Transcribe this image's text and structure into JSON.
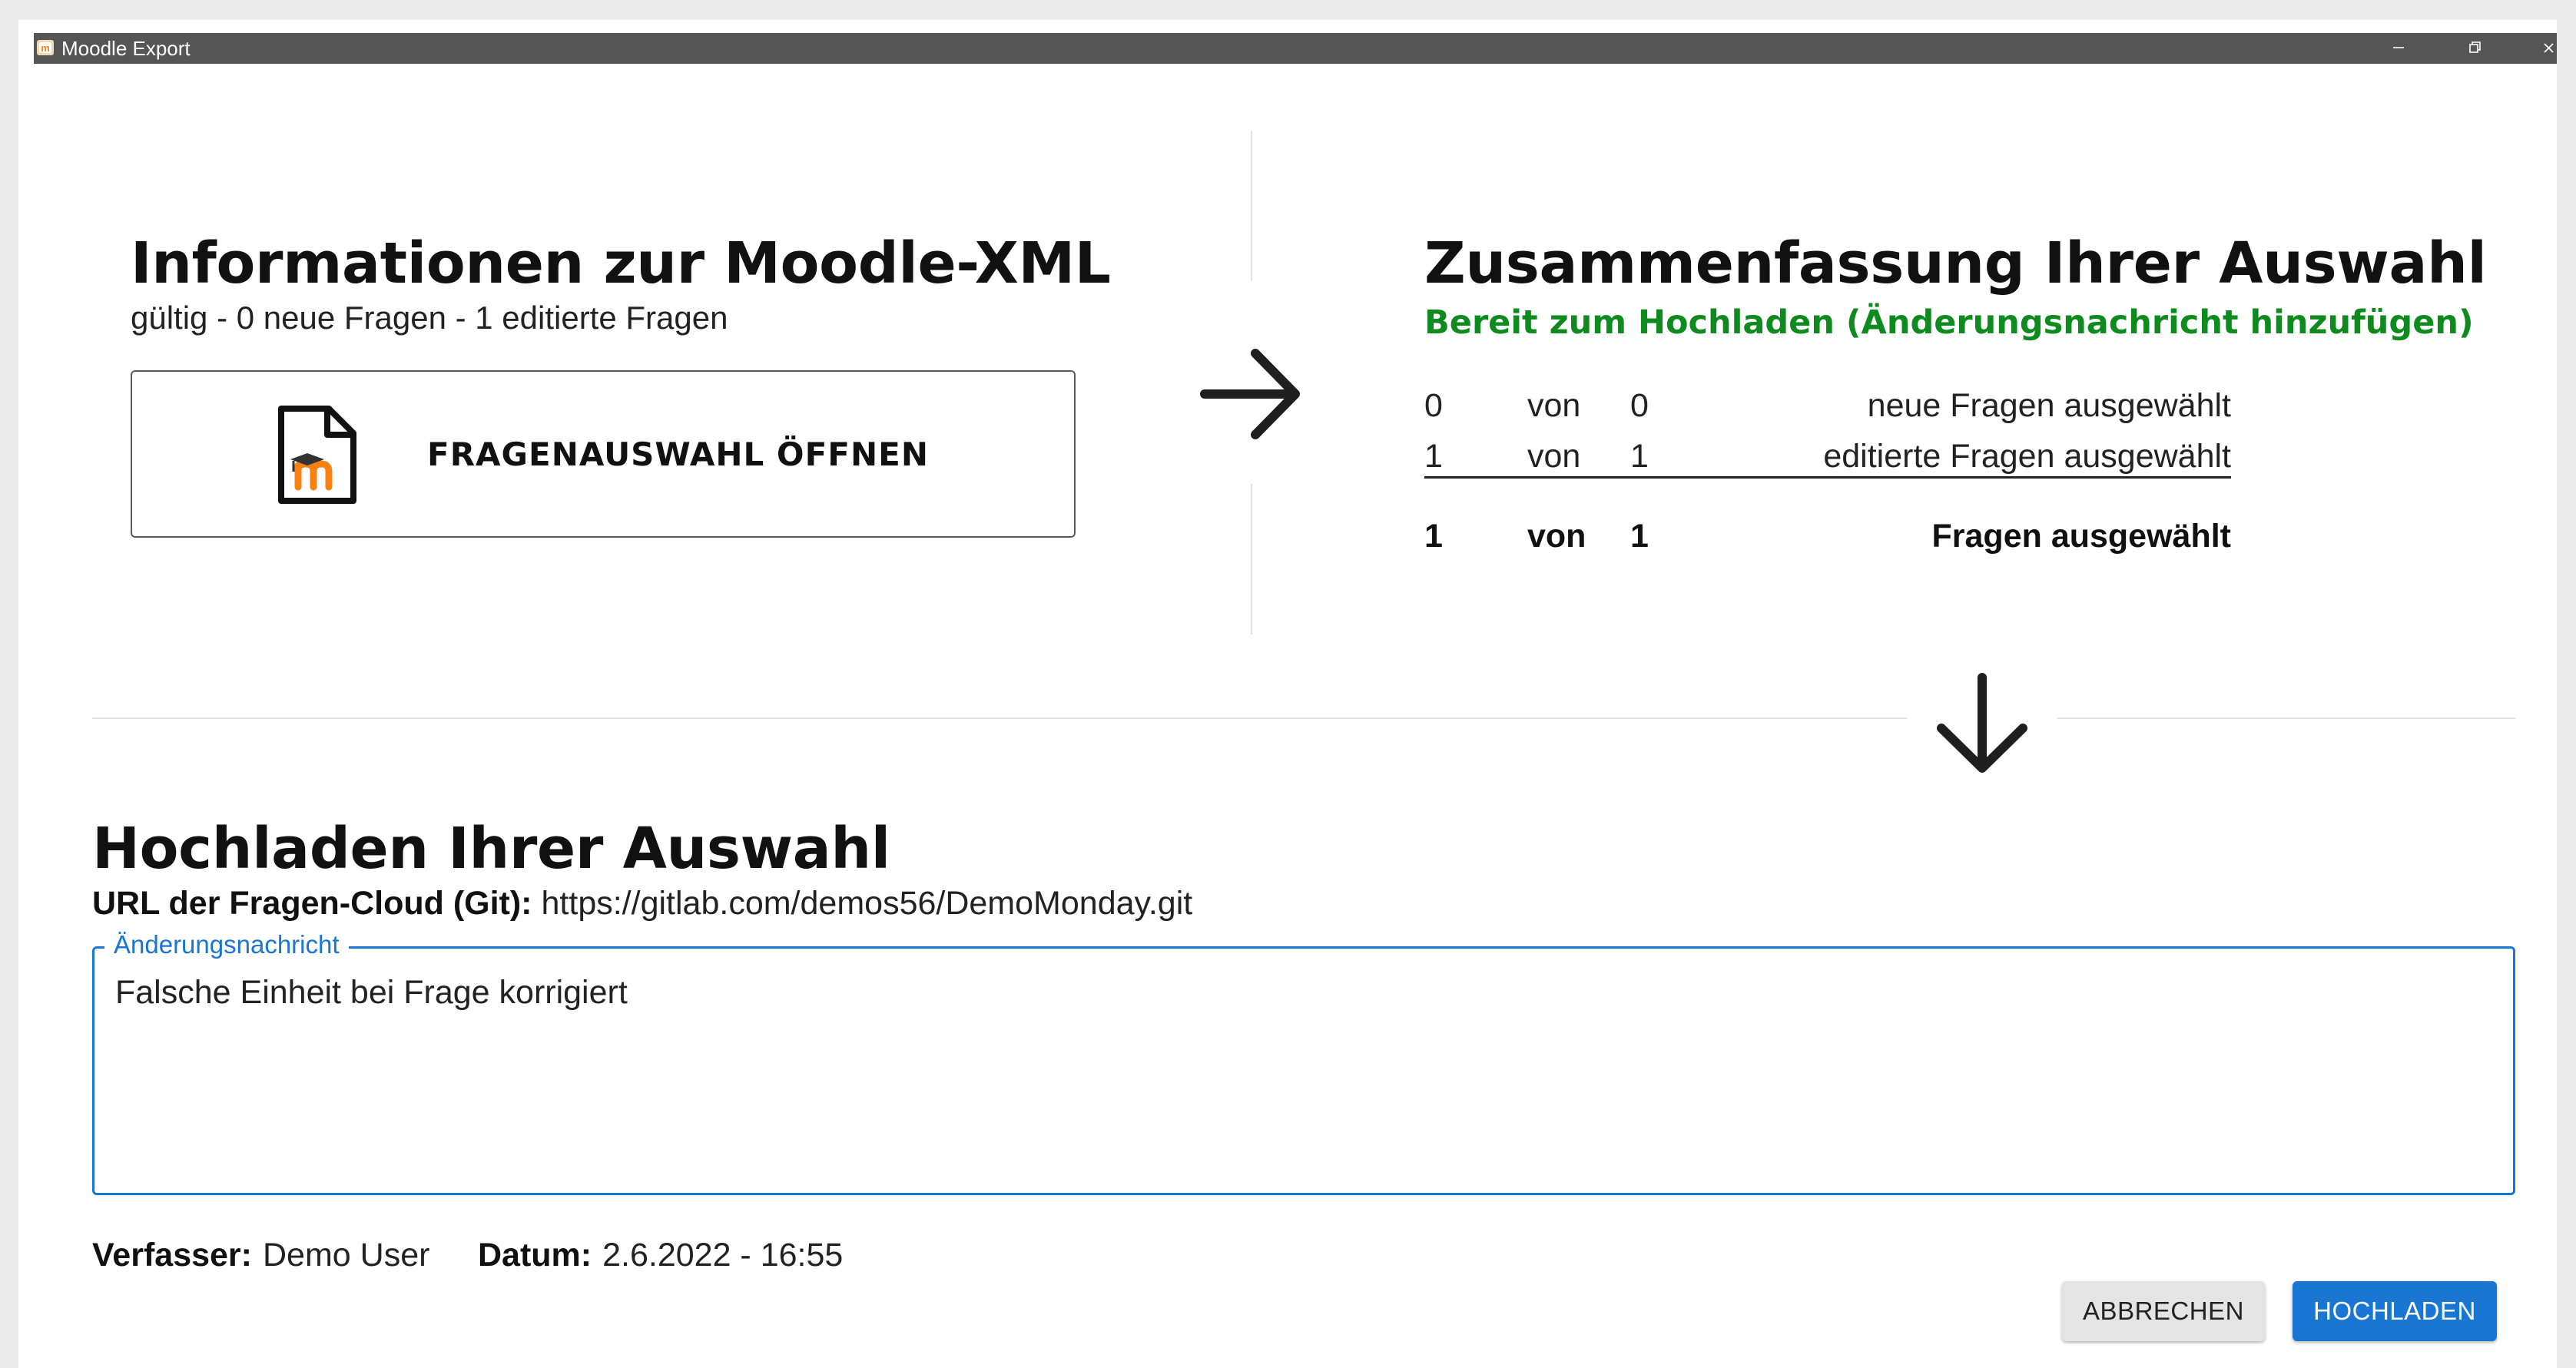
{
  "window": {
    "title": "Moodle Export"
  },
  "info": {
    "heading": "Informationen zur Moodle-XML",
    "status": "gültig - 0 neue Fragen - 1 editierte Fragen",
    "open_button_label": "FRAGENAUSWAHL ÖFFNEN"
  },
  "summary": {
    "heading": "Zusammenfassung Ihrer Auswahl",
    "ready_text": "Bereit zum Hochladen (Änderungsnachricht hinzufügen)",
    "rows": [
      {
        "selected": "0",
        "of": "von",
        "total": "0",
        "label": "neue Fragen ausgewählt"
      },
      {
        "selected": "1",
        "of": "von",
        "total": "1",
        "label": "editierte Fragen ausgewählt"
      }
    ],
    "total": {
      "selected": "1",
      "of": "von",
      "total": "1",
      "label": "Fragen ausgewählt"
    }
  },
  "upload": {
    "heading": "Hochladen Ihrer Auswahl",
    "url_label": "URL der Fragen-Cloud (Git):",
    "url_value": "https://gitlab.com/demos56/DemoMonday.git",
    "message_label": "Änderungsnachricht",
    "message_value": "Falsche Einheit bei Frage korrigiert",
    "author_label": "Verfasser:",
    "author_value": "Demo User",
    "date_label": "Datum:",
    "date_value": "2.6.2022 - 16:55",
    "cancel_label": "ABBRECHEN",
    "upload_label": "HOCHLADEN"
  },
  "colors": {
    "accent": "#1976d2",
    "ready": "#0f8a1e",
    "titlebar": "#555555"
  },
  "icons": {
    "app": "moodle-app-icon",
    "file": "moodle-file-icon",
    "arrow_right": "arrow-right-icon",
    "arrow_down": "arrow-down-icon"
  }
}
